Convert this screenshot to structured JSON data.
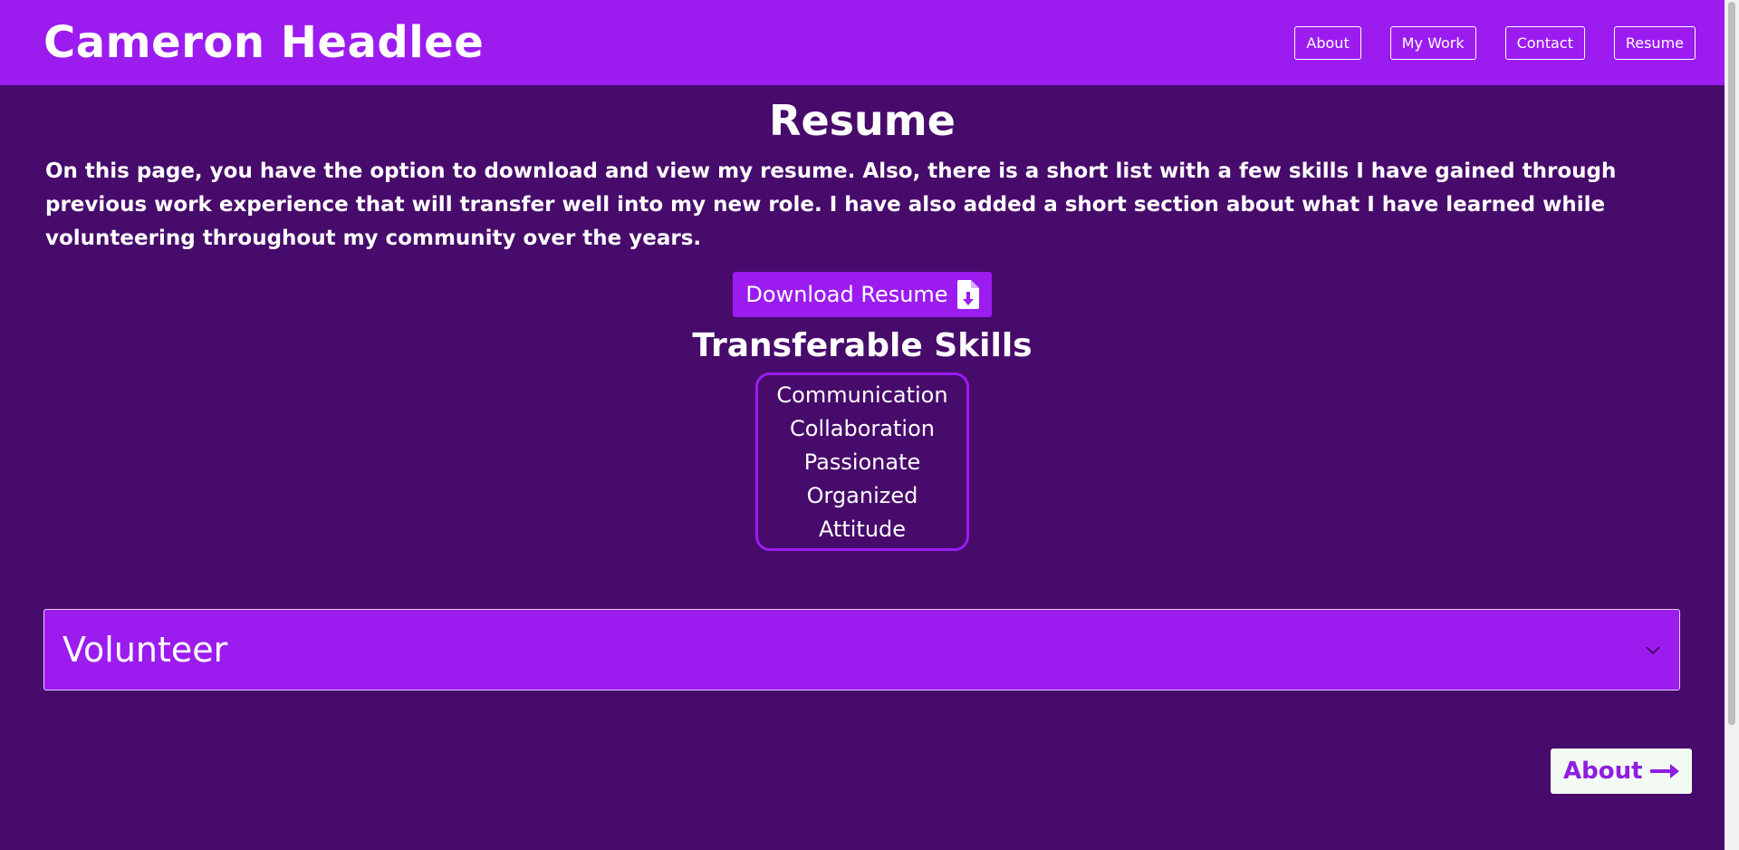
{
  "header": {
    "brand": "Cameron Headlee",
    "nav": [
      "About",
      "My Work",
      "Contact",
      "Resume"
    ]
  },
  "main": {
    "title": "Resume",
    "intro": "On this page, you have the option to download and view my resume. Also, there is a short list with a few skills I have gained through previous work experience that will transfer well into my new role. I have also added a short section about what I have learned while volunteering throughout my community over the years.",
    "download_label": "Download Resume",
    "skills_title": "Transferable Skills",
    "skills": [
      "Communication",
      "Collaboration",
      "Passionate",
      "Organized",
      "Attitude"
    ],
    "accordion_label": "Volunteer",
    "next_label": "About"
  },
  "icons": {
    "download": "file-download-icon",
    "accordion": "chevron-down-icon",
    "next": "arrow-right-icon"
  },
  "colors": {
    "background": "#470b6b",
    "accent": "#9c1cf0",
    "next_button_bg": "#f3faf3"
  }
}
